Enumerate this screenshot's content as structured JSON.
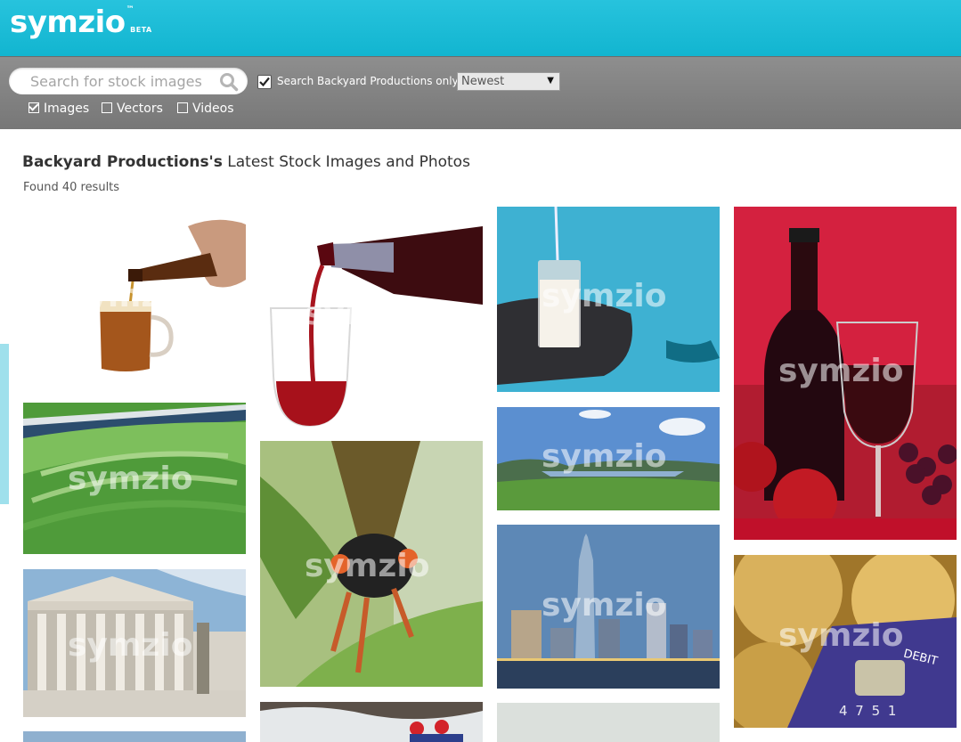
{
  "brand": {
    "logo": "symzio",
    "tm": "™",
    "beta": "BETA"
  },
  "search": {
    "placeholder": "Search for stock images",
    "value": ""
  },
  "filter": {
    "only_label": "Search Backyard Productions only",
    "only_checked": true
  },
  "sort": {
    "selected": "Newest"
  },
  "types": [
    {
      "label": "Images",
      "checked": true
    },
    {
      "label": "Vectors",
      "checked": false
    },
    {
      "label": "Videos",
      "checked": false
    }
  ],
  "heading": {
    "owner": "Backyard Productions's",
    "rest": " Latest Stock Images and Photos"
  },
  "results_text": "Found 40 results",
  "watermark": "symzio",
  "colors": {
    "header": "#18b9d4",
    "toolbar": "#808080"
  },
  "gallery": [
    {
      "subject": "beer pouring into mug"
    },
    {
      "subject": "green pool"
    },
    {
      "subject": "supreme court building"
    },
    {
      "subject": "sky"
    },
    {
      "subject": "red wine pouring into glass"
    },
    {
      "subject": "cicada on leaf"
    },
    {
      "subject": "river rafting"
    },
    {
      "subject": "milk glass on table by pool"
    },
    {
      "subject": "lake valley landscape"
    },
    {
      "subject": "city skyline at dusk"
    },
    {
      "subject": "grey"
    },
    {
      "subject": "red wine bottle and grapes"
    },
    {
      "subject": "gold coins and debit card",
      "card_text": "DEBIT",
      "card_number": "4 7 5 1"
    }
  ]
}
